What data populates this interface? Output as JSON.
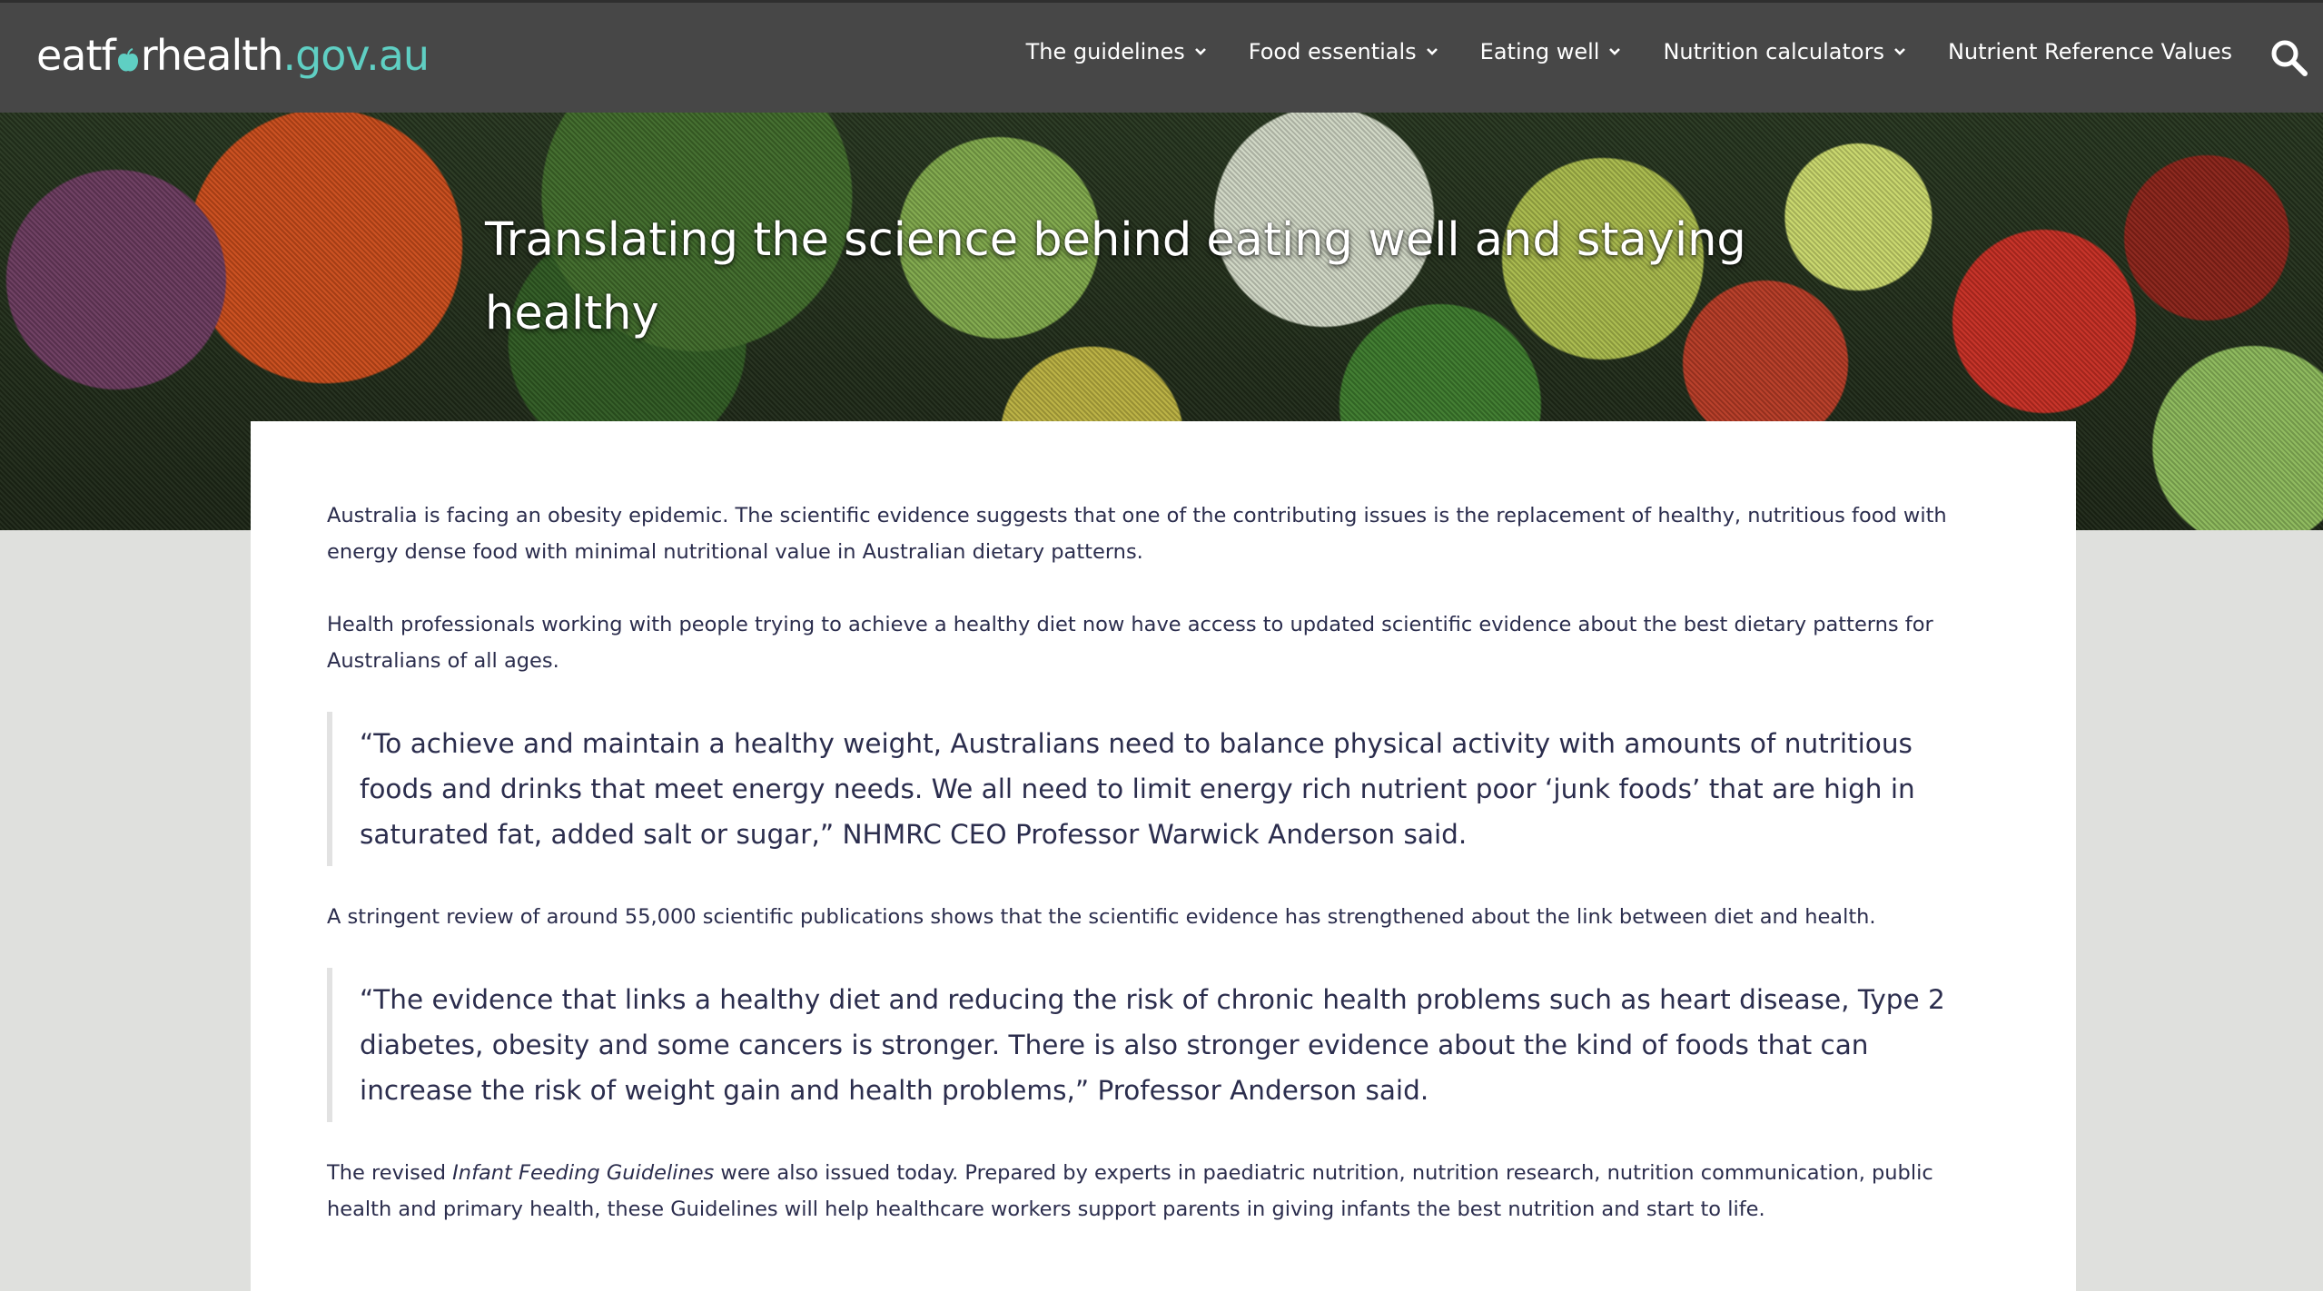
{
  "header": {
    "logo": {
      "part1": "eatf",
      "part2": "rhealth",
      "part3": ".gov.au"
    },
    "nav": [
      {
        "label": "The guidelines",
        "has_dropdown": true
      },
      {
        "label": "Food essentials",
        "has_dropdown": true
      },
      {
        "label": "Eating well",
        "has_dropdown": true
      },
      {
        "label": "Nutrition calculators",
        "has_dropdown": true
      },
      {
        "label": "Nutrient Reference Values",
        "has_dropdown": false
      }
    ],
    "search_icon": "search-icon"
  },
  "hero": {
    "title": "Translating the science behind eating well and staying healthy"
  },
  "article": {
    "p1": "Australia is facing an obesity epidemic.  The scientific evidence suggests that one of the contributing issues is the replacement of healthy, nutritious food with energy dense food with minimal nutritional value in Australian dietary patterns.",
    "p2": "Health professionals working with people trying to achieve a healthy diet now have access to updated scientific evidence about the best dietary patterns for Australians of all ages.",
    "quote1": "“To achieve and maintain a healthy weight, Australians need to balance physical activity with amounts of nutritious foods and drinks that meet energy needs. We all need to limit energy rich nutrient poor ‘junk foods’ that are high in saturated fat, added salt or sugar,” NHMRC CEO Professor Warwick Anderson said.",
    "p3": "A stringent review of around 55,000 scientific publications shows that the scientific evidence has strengthened about the link between diet and health.",
    "quote2": "“The evidence that links a healthy diet and reducing the risk of chronic health problems such as heart disease, Type 2 diabetes, obesity and some cancers is stronger.  There is also stronger evidence about the kind of foods that can increase the risk of weight gain and health problems,” Professor Anderson said.",
    "p4_before": "The revised ",
    "p4_italic": "Infant Feeding Guidelines",
    "p4_after": " were also issued today. Prepared by experts in paediatric nutrition, nutrition research, nutrition communication, public health and primary health, these Guidelines will help healthcare workers support parents in giving infants the best nutrition and start to life."
  },
  "colors": {
    "header_bg": "#474747",
    "logo_accent": "#5fcfc3",
    "body_text": "#2b2d4d",
    "page_bg": "#dfe0dd"
  }
}
